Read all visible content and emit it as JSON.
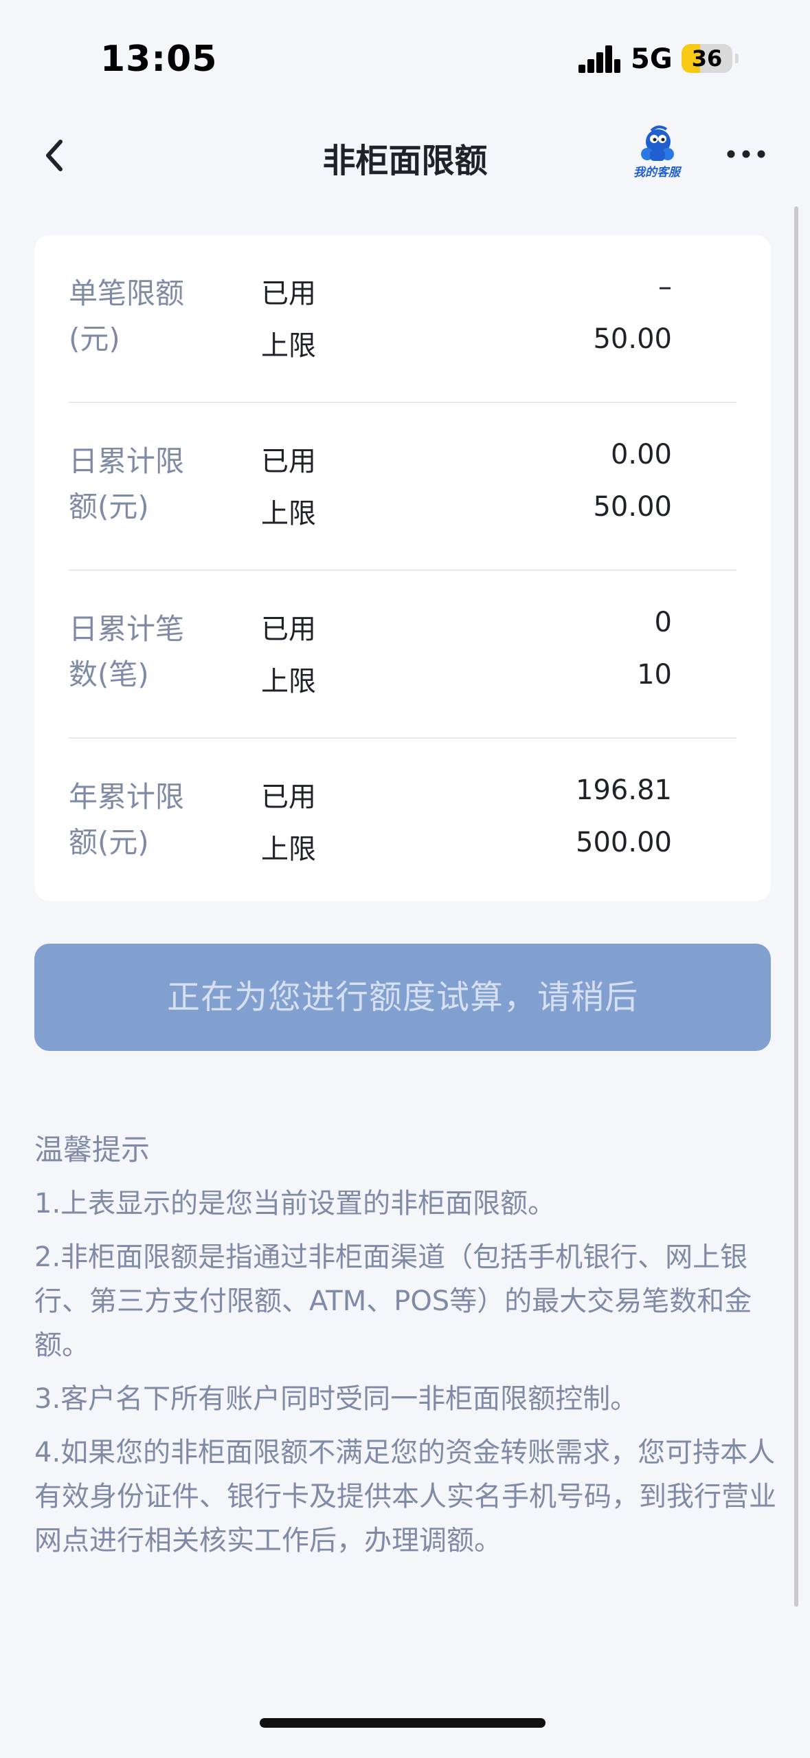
{
  "status_bar": {
    "time": "13:05",
    "network": "5G",
    "battery_level": "36",
    "battery_fraction": 0.36,
    "signal_icon": "signal-bars-icon"
  },
  "nav": {
    "title": "非柜面限额",
    "back_icon": "chevron-left-icon",
    "service_label": "我的客服",
    "service_icon": "customer-service-mascot-icon",
    "more_icon": "more-horizontal-icon"
  },
  "limits": [
    {
      "name": "单笔限额(元)",
      "used_label": "已用",
      "used_value": "–",
      "limit_label": "上限",
      "limit_value": "50.00"
    },
    {
      "name": "日累计限额(元)",
      "used_label": "已用",
      "used_value": "0.00",
      "limit_label": "上限",
      "limit_value": "50.00"
    },
    {
      "name": "日累计笔数(笔)",
      "used_label": "已用",
      "used_value": "0",
      "limit_label": "上限",
      "limit_value": "10"
    },
    {
      "name": "年累计限额(元)",
      "used_label": "已用",
      "used_value": "196.81",
      "limit_label": "上限",
      "limit_value": "500.00"
    }
  ],
  "calc_button": {
    "label": "正在为您进行额度试算，请稍后"
  },
  "tips": {
    "title": "温馨提示",
    "items": [
      "1.上表显示的是您当前设置的非柜面限额。",
      "2.非柜面限额是指通过非柜面渠道（包括手机银行、网上银行、第三方支付限额、ATM、POS等）的最大交易笔数和金额。",
      "3.客户名下所有账户同时受同一非柜面限额控制。",
      "4.如果您的非柜面限额不满足您的资金转账需求，您可持本人有效身份证件、银行卡及提供本人实名手机号码，到我行营业网点进行相关核实工作后，办理调额。"
    ]
  },
  "colors": {
    "background": "#f5f6fa",
    "card": "#ffffff",
    "label_gray": "#7e8aa6",
    "button_bg": "#819fcf",
    "button_text": "#d6e0f1",
    "battery": "#f7c814"
  }
}
